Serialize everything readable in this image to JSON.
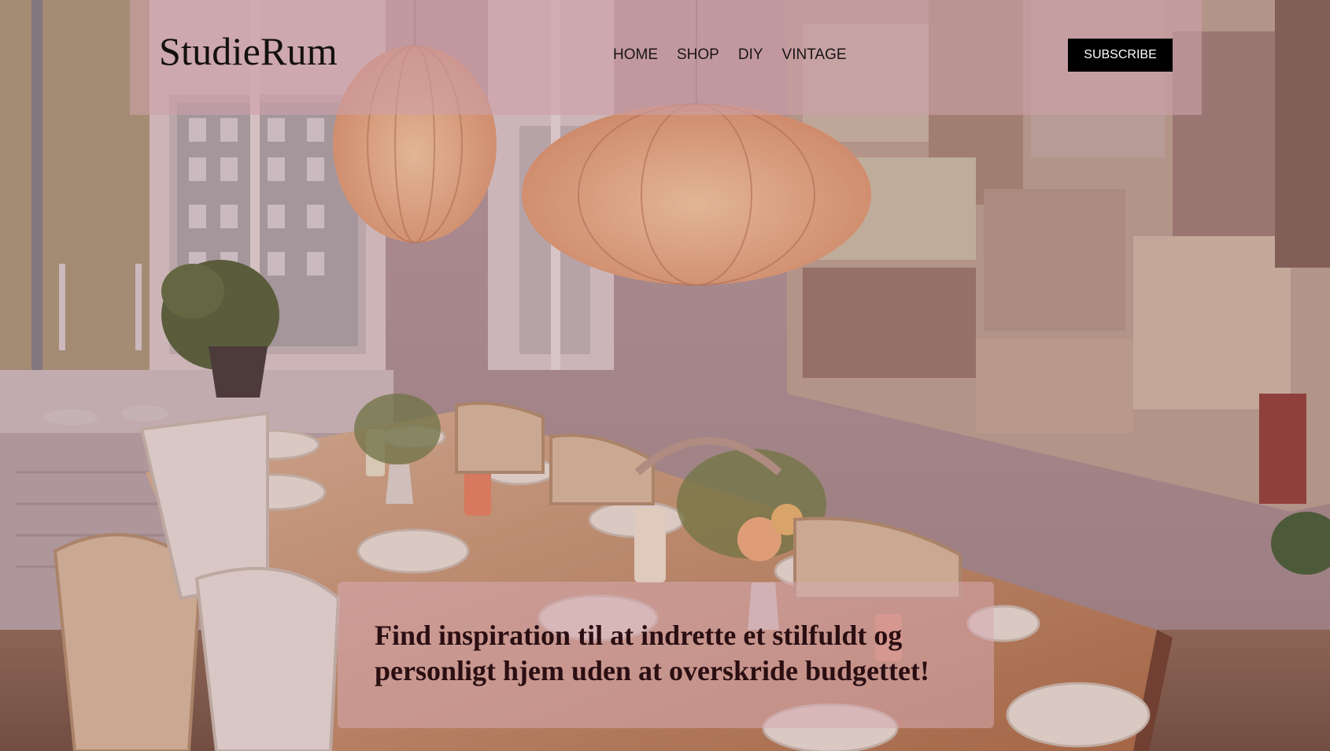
{
  "site": {
    "logo": "StudieRum"
  },
  "nav": {
    "items": [
      {
        "label": "HOME"
      },
      {
        "label": "SHOP"
      },
      {
        "label": "DIY"
      },
      {
        "label": "VINTAGE"
      }
    ]
  },
  "header": {
    "subscribe_label": "SUBSCRIBE"
  },
  "hero": {
    "tagline": "Find inspiration til at indrette et stilfuldt og personligt hjem uden at overskride budgettet!"
  },
  "colors": {
    "header_overlay": "#cda0a8",
    "button_bg": "#000000",
    "button_text": "#ffffff",
    "tagline_text": "#2a0e12"
  }
}
